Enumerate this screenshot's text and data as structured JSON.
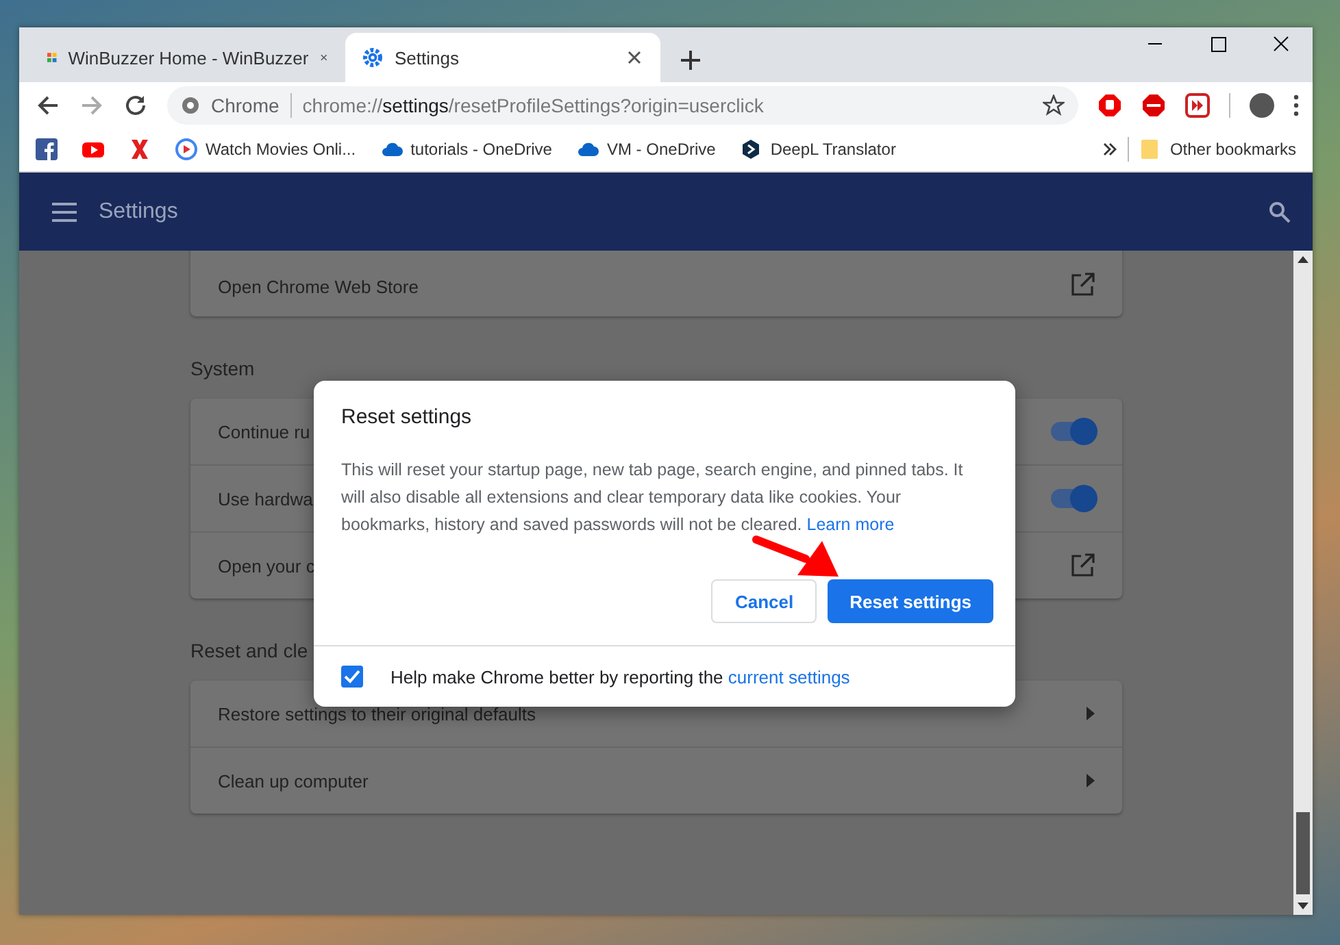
{
  "tabs": [
    {
      "title": "WinBuzzer Home - WinBuzzer",
      "selected": false
    },
    {
      "title": "Settings",
      "selected": true
    }
  ],
  "toolbar": {
    "site_label": "Chrome",
    "url_prefix": "chrome://",
    "url_host": "settings",
    "url_path": "/resetProfileSettings?origin=userclick"
  },
  "bookmarks": [
    {
      "label": "Watch Movies Onli..."
    },
    {
      "label": "tutorials - OneDrive"
    },
    {
      "label": "VM - OneDrive"
    },
    {
      "label": "DeepL Translator"
    }
  ],
  "other_bookmarks": "Other bookmarks",
  "header": {
    "title": "Settings"
  },
  "sections": [
    {
      "rows": [
        {
          "kind": "link",
          "sublabel": "Open Chrome Web Store"
        }
      ]
    },
    {
      "heading": "System",
      "rows": [
        {
          "kind": "toggle",
          "label": "Continue ru",
          "on": true
        },
        {
          "kind": "toggle",
          "label": "Use hardwa",
          "on": true
        },
        {
          "kind": "link",
          "label": "Open your c"
        }
      ]
    },
    {
      "heading": "Reset and cle",
      "rows": [
        {
          "kind": "arrow",
          "label": "Restore settings to their original defaults"
        },
        {
          "kind": "arrow",
          "label": "Clean up computer"
        }
      ]
    }
  ],
  "dialog": {
    "title": "Reset settings",
    "body": "This will reset your startup page, new tab page, search engine, and pinned tabs. It will also disable all extensions and clear temporary data like cookies. Your bookmarks, history and saved passwords will not be cleared.",
    "learn_more": "Learn more",
    "cancel": "Cancel",
    "confirm": "Reset settings",
    "report_checked": true,
    "report_text": "Help make Chrome better by reporting the",
    "report_link": "current settings"
  }
}
